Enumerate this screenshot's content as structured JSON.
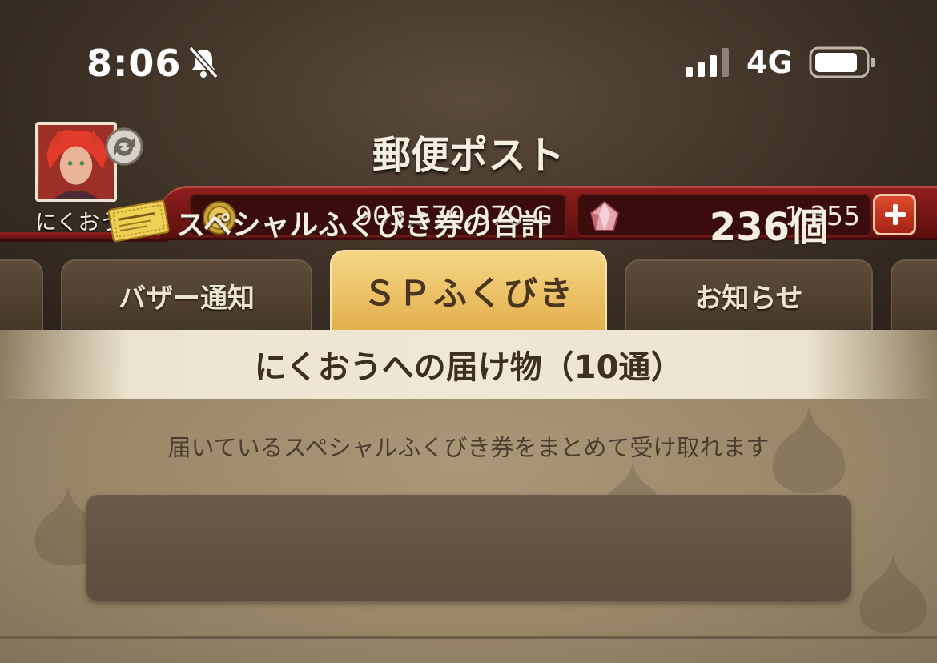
{
  "status_bar": {
    "time": "8:06",
    "network": "4G",
    "icons": [
      "bell-muted-icon",
      "signal-icon",
      "battery-icon"
    ]
  },
  "header": {
    "title": "郵便ポスト",
    "player_name": "にくおう",
    "gold": "905,570,970 G",
    "gems": "1,355"
  },
  "tabs": [
    {
      "label": "バザー通知",
      "active": false
    },
    {
      "label": "ＳＰふくびき",
      "active": true
    },
    {
      "label": "お知らせ",
      "active": false
    }
  ],
  "main": {
    "banner": "にくおうへの届け物（10通）",
    "description": "届いているスペシャルふくびき券をまとめて受け取れます",
    "total_label": "スペシャルふくびき券の合計",
    "total_value": "236個"
  },
  "colors": {
    "accent_tab": "#e8b956",
    "currency_band": "#7a1614",
    "parchment": "#a39170"
  }
}
